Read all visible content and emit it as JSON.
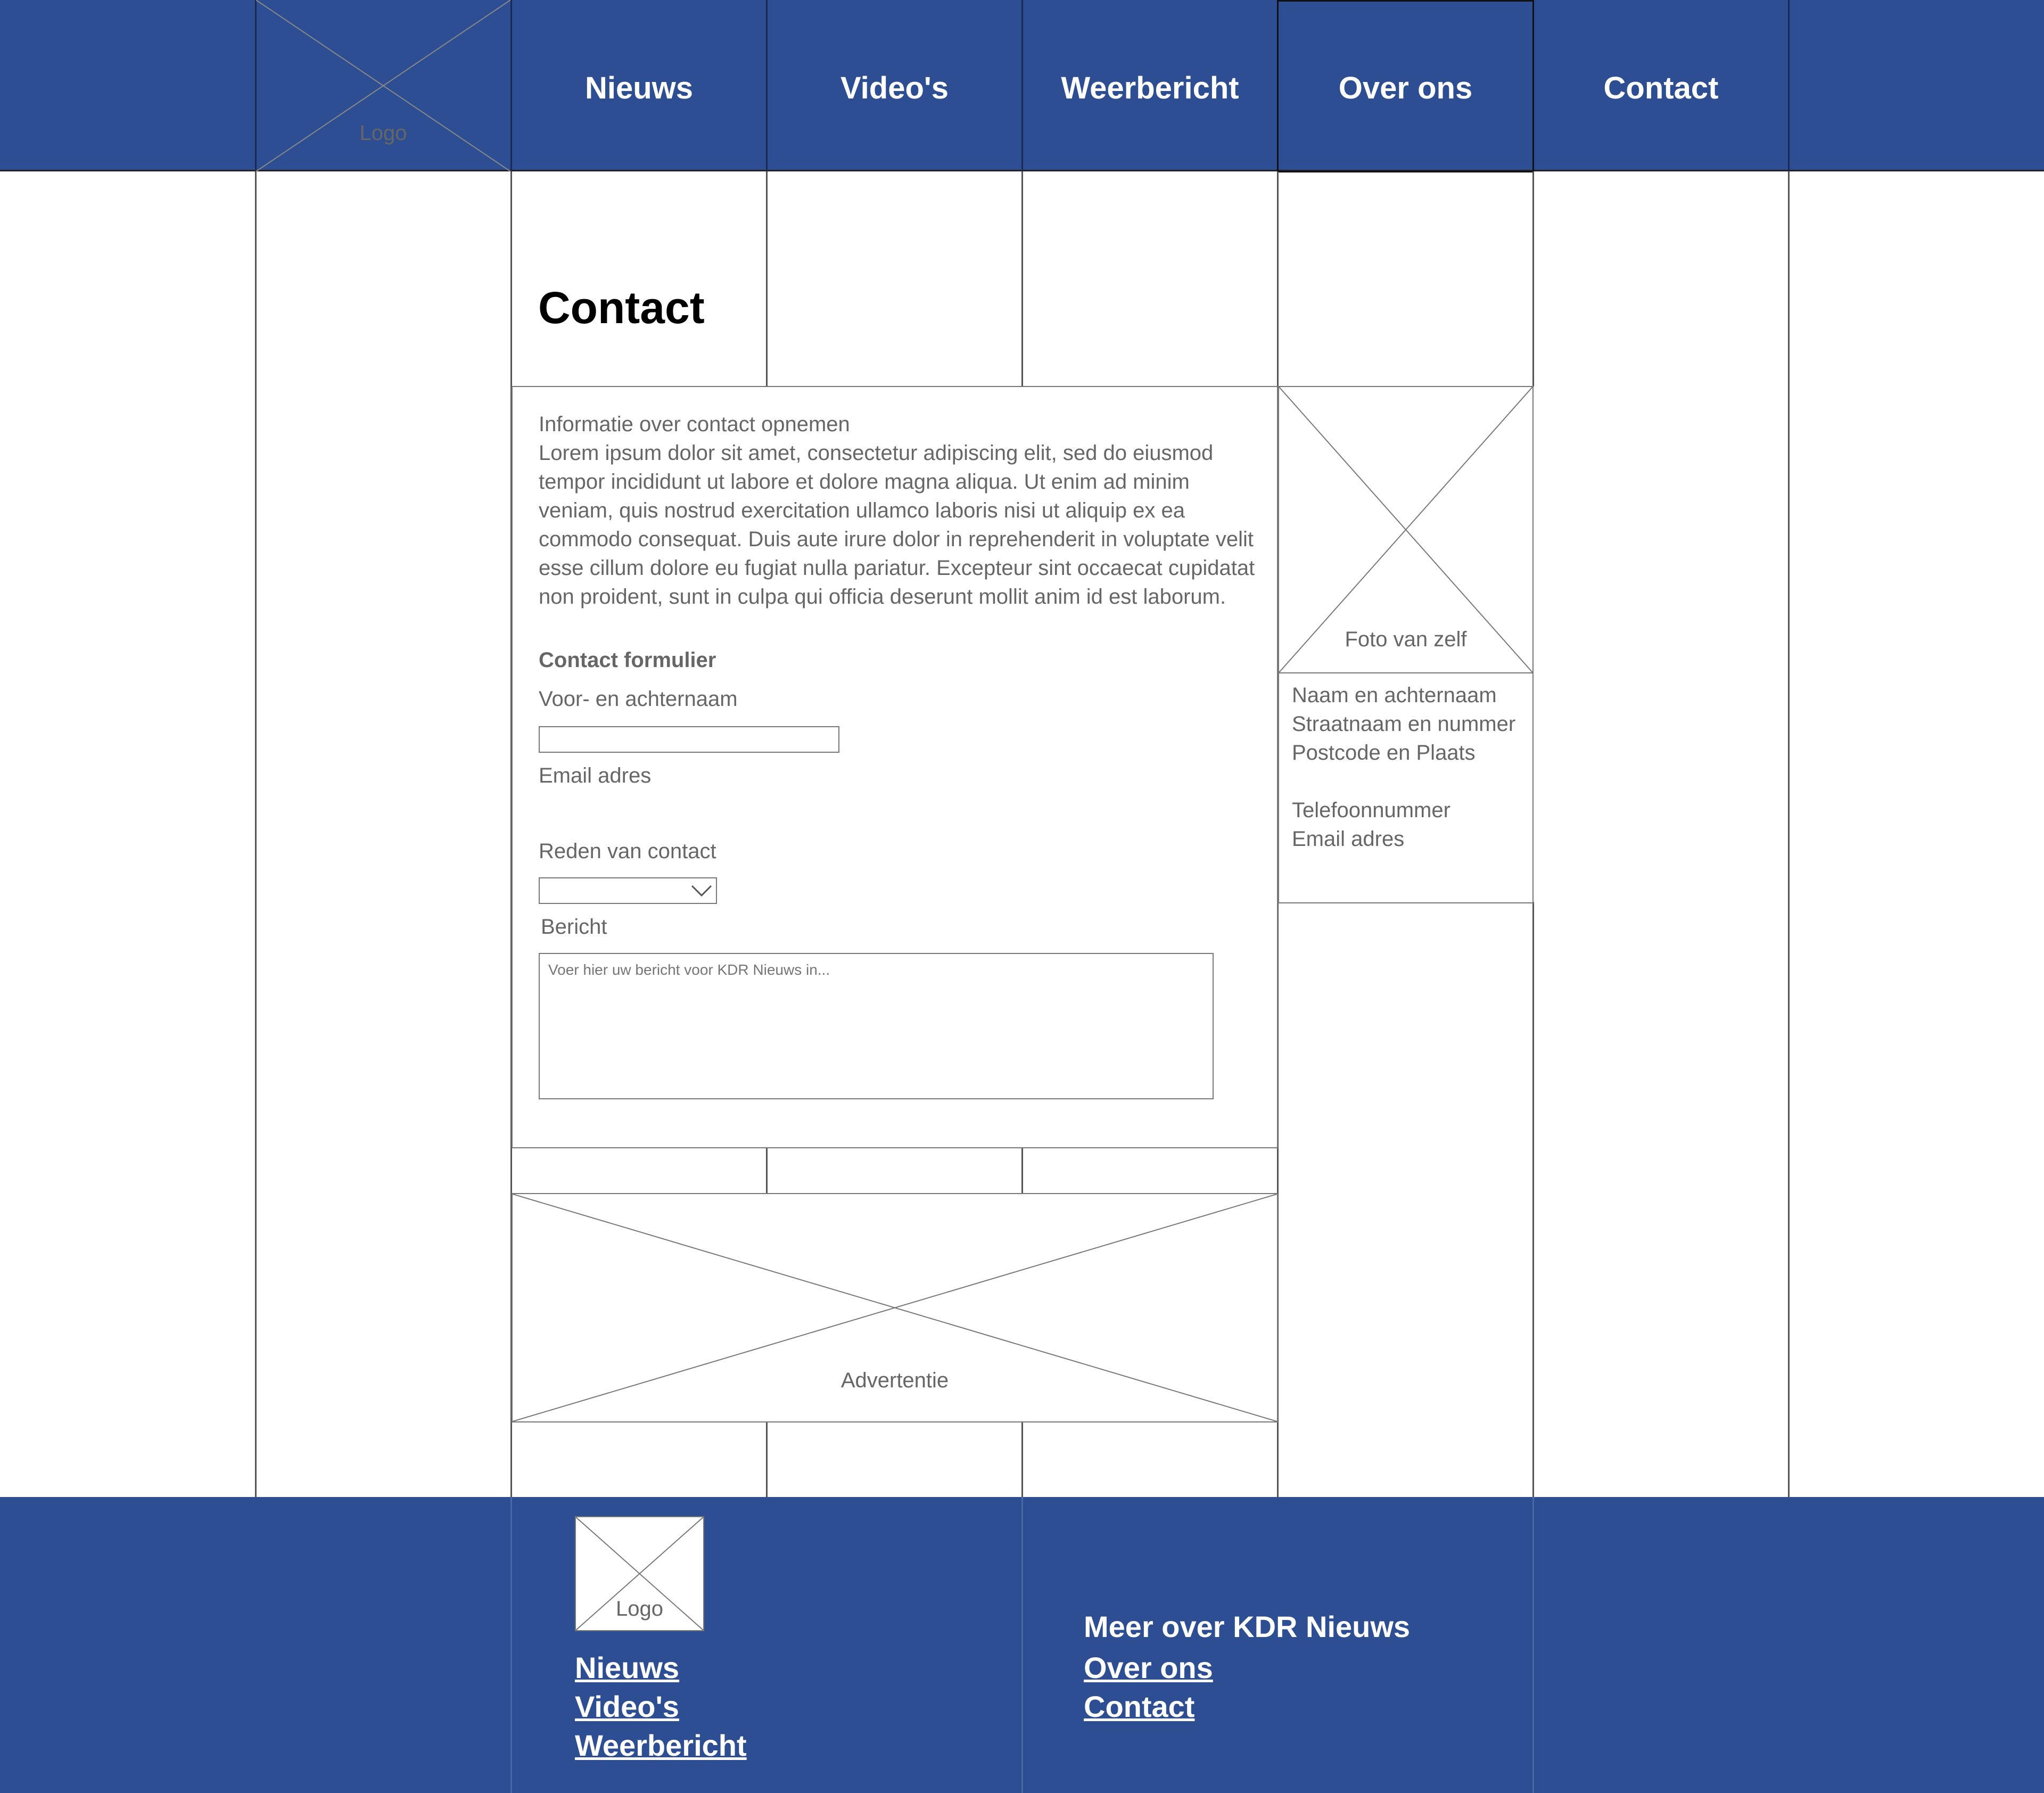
{
  "nav": {
    "logo_label": "Logo",
    "items": [
      {
        "label": "Nieuws"
      },
      {
        "label": "Video's"
      },
      {
        "label": "Weerbericht"
      },
      {
        "label": "Over ons"
      },
      {
        "label": "Contact"
      }
    ]
  },
  "page": {
    "title": "Contact"
  },
  "info": {
    "heading": "Informatie over contact opnemen",
    "lines": [
      "Lorem ipsum dolor sit amet, consectetur adipiscing elit, sed do eiusmod",
      "tempor incididunt ut labore et dolore magna aliqua. Ut enim ad minim",
      "veniam, quis nostrud exercitation ullamco laboris nisi ut aliquip ex ea",
      "commodo consequat. Duis aute irure dolor in reprehenderit in voluptate velit",
      "esse cillum dolore eu fugiat nulla pariatur. Excepteur sint occaecat cupidatat",
      "non proident, sunt in culpa qui officia deserunt mollit anim id est laborum."
    ]
  },
  "form": {
    "title": "Contact formulier",
    "name_label": "Voor- en achternaam",
    "name_value": "",
    "email_label": "Email adres",
    "reason_label": "Reden van contact",
    "reason_value": "",
    "message_label": "Bericht",
    "message_placeholder": "Voer hier uw bericht voor KDR Nieuws in..."
  },
  "profile": {
    "photo_label": "Foto van zelf",
    "name": "Naam en achternaam",
    "street": "Straatnaam en nummer",
    "postcode": "Postcode en Plaats",
    "phone": "Telefoonnummer",
    "email": "Email adres"
  },
  "ad": {
    "label": "Advertentie"
  },
  "footer": {
    "logo_label": "Logo",
    "links_left": [
      {
        "label": "Nieuws"
      },
      {
        "label": "Video's"
      },
      {
        "label": "Weerbericht"
      }
    ],
    "more_heading": "Meer over KDR Nieuws",
    "links_right": [
      {
        "label": "Over ons"
      },
      {
        "label": "Contact"
      }
    ]
  },
  "colors": {
    "brand_blue": "#2d4e93",
    "placeholder_grey": "#666666"
  }
}
